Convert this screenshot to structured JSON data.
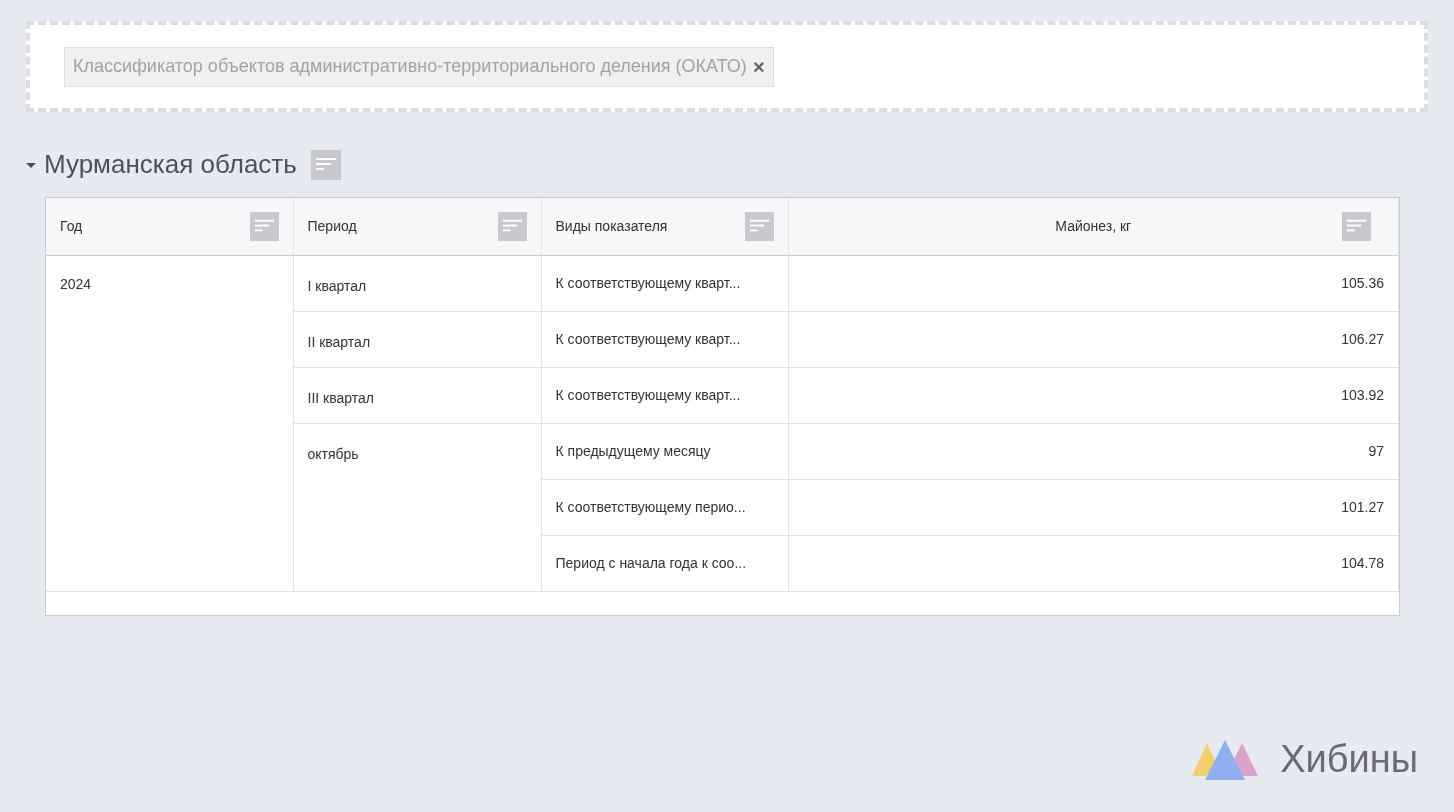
{
  "filter_chips": [
    {
      "label": "Классификатор объектов административно-территориального деления (ОКАТО)",
      "close": "×"
    }
  ],
  "section": {
    "title": "Мурманская область",
    "expanded": true
  },
  "table": {
    "columns": [
      "Год",
      "Период",
      "Виды показателя",
      "Майонез, кг"
    ],
    "rows": [
      {
        "year": "2024",
        "periods": [
          {
            "label": "I квартал",
            "indicators": [
              {
                "label": "К соответствующему кварт...",
                "value": "105.36"
              }
            ]
          },
          {
            "label": "II квартал",
            "indicators": [
              {
                "label": "К соответствующему кварт...",
                "value": "106.27"
              }
            ]
          },
          {
            "label": "III квартал",
            "indicators": [
              {
                "label": "К соответствующему кварт...",
                "value": "103.92"
              }
            ]
          },
          {
            "label": "октябрь",
            "indicators": [
              {
                "label": "К предыдущему месяцу",
                "value": "97"
              },
              {
                "label": "К соответствующему перио...",
                "value": "101.27"
              },
              {
                "label": "Период с начала года к соо...",
                "value": "104.78"
              }
            ]
          }
        ]
      }
    ]
  },
  "logo": {
    "text": "Хибины"
  }
}
